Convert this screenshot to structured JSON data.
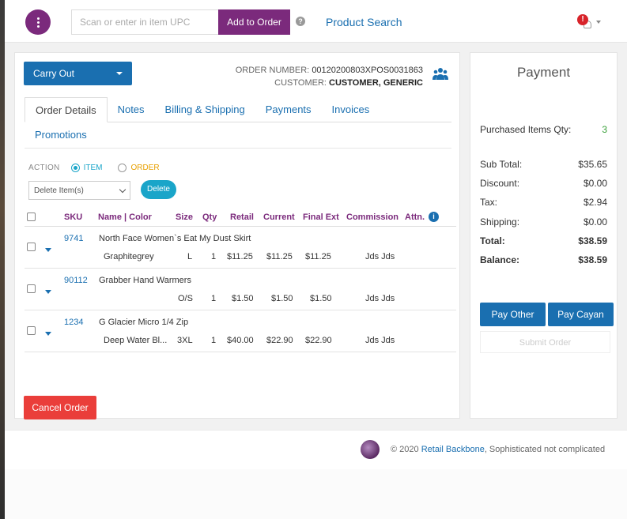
{
  "header": {
    "scan_placeholder": "Scan or enter in item UPC",
    "add_to_order_label": "Add to Order",
    "help_glyph": "?",
    "product_search_label": "Product Search",
    "notification_glyph": "!"
  },
  "order": {
    "type_label": "Carry Out",
    "number_label": "ORDER NUMBER:",
    "number_value": "00120200803XPOS0031863",
    "customer_label": "CUSTOMER:",
    "customer_value": "CUSTOMER, GENERIC"
  },
  "tabs": [
    "Order Details",
    "Notes",
    "Billing & Shipping",
    "Payments",
    "Invoices",
    "Promotions"
  ],
  "action": {
    "label": "ACTION",
    "item_label": "ITEM",
    "order_label": "ORDER",
    "select_value": "Delete Item(s)",
    "delete_label": "Delete"
  },
  "table": {
    "headers": {
      "sku": "SKU",
      "name": "Name | Color",
      "size": "Size",
      "qty": "Qty",
      "retail": "Retail",
      "current": "Current",
      "final_ext": "Final Ext",
      "commission": "Commission",
      "attn": "Attn.",
      "info_glyph": "i"
    },
    "rows": [
      {
        "sku": "9741",
        "name": "North Face Women`s Eat My Dust Skirt",
        "color": "Graphitegrey",
        "size": "L",
        "qty": "1",
        "retail": "$11.25",
        "current": "$11.25",
        "final_ext": "$11.25",
        "commission": "Jds Jds"
      },
      {
        "sku": "90112",
        "name": "Grabber Hand Warmers",
        "color": "",
        "size": "O/S",
        "qty": "1",
        "retail": "$1.50",
        "current": "$1.50",
        "final_ext": "$1.50",
        "commission": "Jds Jds"
      },
      {
        "sku": "1234",
        "name": "G Glacier Micro 1/4 Zip",
        "color": "Deep Water Bl...",
        "size": "3XL",
        "qty": "1",
        "retail": "$40.00",
        "current": "$22.90",
        "final_ext": "$22.90",
        "commission": "Jds Jds"
      }
    ]
  },
  "cancel_label": "Cancel Order",
  "payment": {
    "title": "Payment",
    "purchased_label": "Purchased Items Qty:",
    "purchased_value": "3",
    "subtotal_label": "Sub Total:",
    "subtotal_value": "$35.65",
    "discount_label": "Discount:",
    "discount_value": "$0.00",
    "tax_label": "Tax:",
    "tax_value": "$2.94",
    "shipping_label": "Shipping:",
    "shipping_value": "$0.00",
    "total_label": "Total:",
    "total_value": "$38.59",
    "balance_label": "Balance:",
    "balance_value": "$38.59",
    "pay_other_label": "Pay Other",
    "pay_cayan_label": "Pay Cayan",
    "submit_label": "Submit Order"
  },
  "footer": {
    "copyright": "© 2020",
    "brand": "Retail Backbone",
    "tagline": ", Sophisticated not complicated"
  },
  "colors": {
    "brand_purple": "#7b2a7c",
    "primary_blue": "#1a6fb0",
    "cyan": "#1aa5c9",
    "danger_red": "#ea3e3a",
    "success_green": "#3aa03a"
  }
}
